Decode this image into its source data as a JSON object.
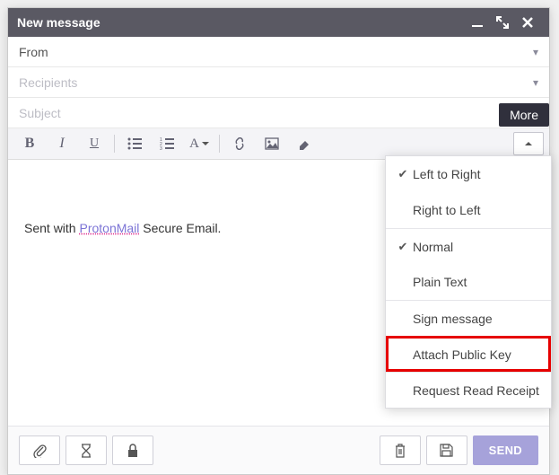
{
  "header": {
    "title": "New message",
    "actions": {
      "minimize": "minimize",
      "expand": "expand",
      "close": "close"
    }
  },
  "fields": {
    "from_label": "From",
    "recipients_placeholder": "Recipients",
    "subject_placeholder": "Subject"
  },
  "toolbar": {
    "bold": "B",
    "italic": "I",
    "underline": "U",
    "font_label": "A",
    "more_tooltip": "More"
  },
  "body": {
    "prefix": "Sent with ",
    "link_text": "ProtonMail",
    "suffix": " Secure Email."
  },
  "dropdown": {
    "ltr": {
      "label": "Left to Right",
      "checked": true
    },
    "rtl": {
      "label": "Right to Left",
      "checked": false
    },
    "normal": {
      "label": "Normal",
      "checked": true
    },
    "plain": {
      "label": "Plain Text",
      "checked": false
    },
    "sign": {
      "label": "Sign message",
      "checked": false
    },
    "attach_key": {
      "label": "Attach Public Key",
      "checked": false
    },
    "read_receipt": {
      "label": "Request Read Receipt",
      "checked": false
    }
  },
  "footer": {
    "send_label": "SEND"
  },
  "colors": {
    "highlight": "#e60000",
    "primary": "#a6a2da"
  }
}
